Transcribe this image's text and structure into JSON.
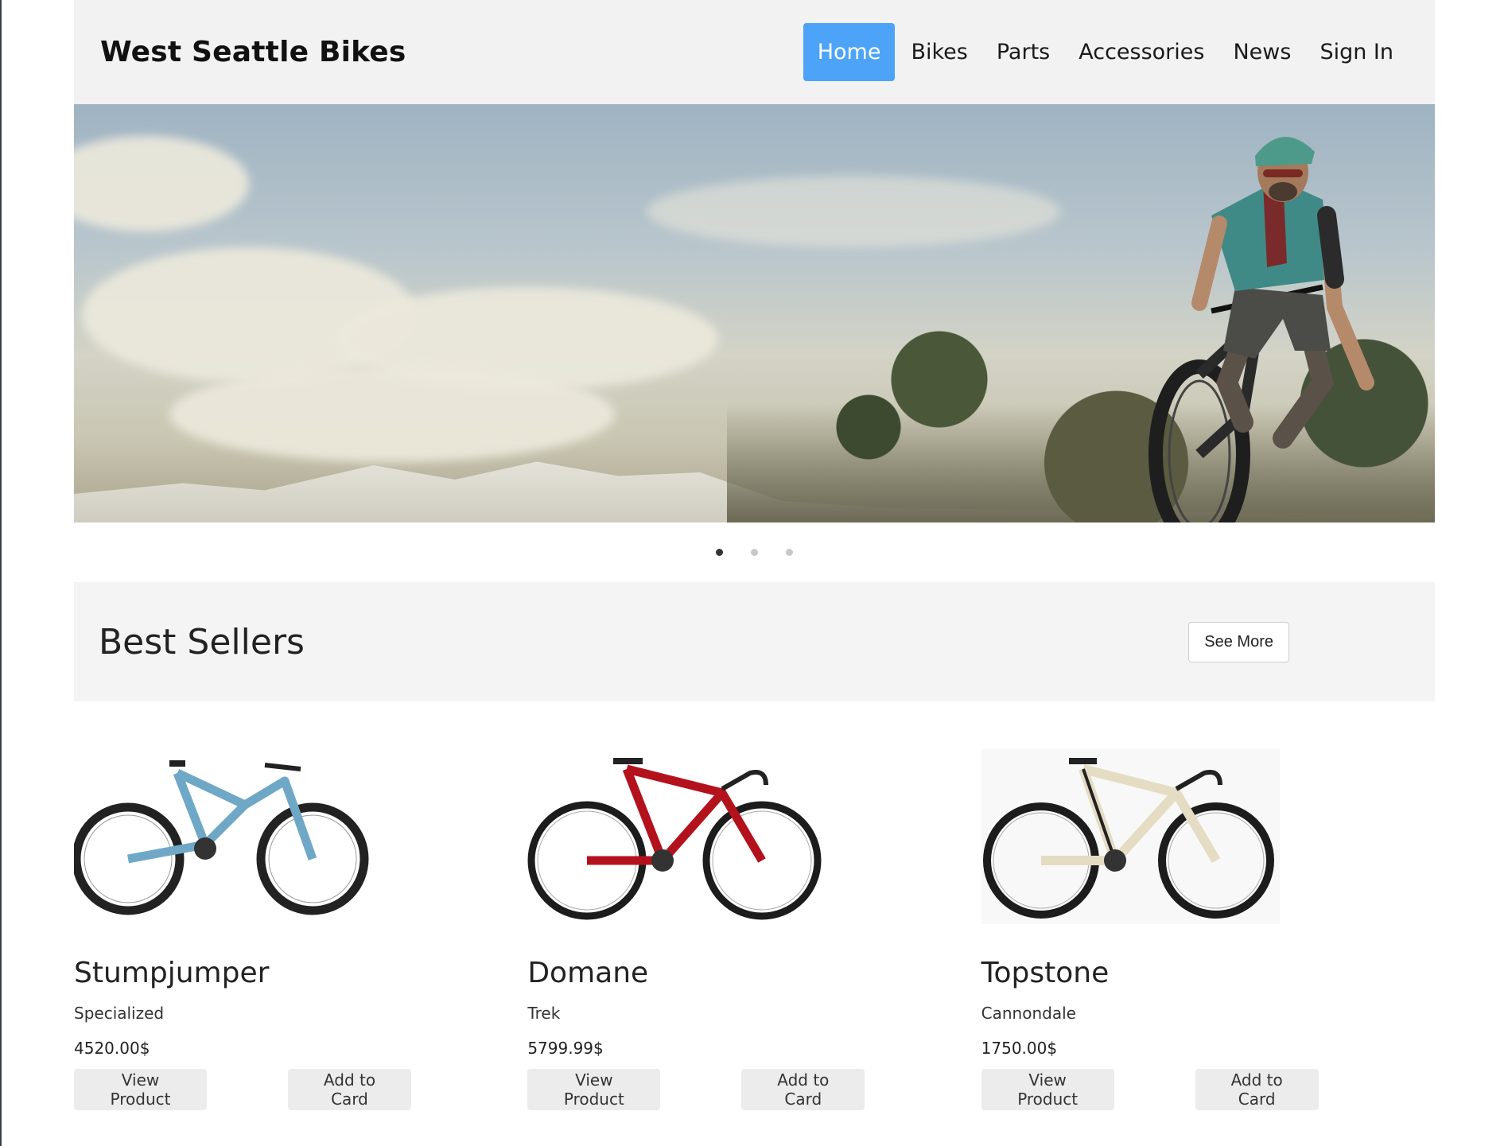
{
  "header": {
    "brand": "West Seattle Bikes",
    "nav": [
      {
        "label": "Home",
        "active": true
      },
      {
        "label": "Bikes",
        "active": false
      },
      {
        "label": "Parts",
        "active": false
      },
      {
        "label": "Accessories",
        "active": false
      },
      {
        "label": "News",
        "active": false
      },
      {
        "label": "Sign In",
        "active": false
      }
    ]
  },
  "carousel": {
    "slide_description": "mountain-biker-hero-photo",
    "slides": 3,
    "active_index": 0
  },
  "best_sellers": {
    "title": "Best Sellers",
    "see_more": "See More",
    "products": [
      {
        "name": "Stumpjumper",
        "brand": "Specialized",
        "price": "4520.00$",
        "view_label": "View Product",
        "add_label": "Add to Card",
        "frame_color": "#6fa8c7"
      },
      {
        "name": "Domane",
        "brand": "Trek",
        "price": "5799.99$",
        "view_label": "View Product",
        "add_label": "Add to Card",
        "frame_color": "#b3121d"
      },
      {
        "name": "Topstone",
        "brand": "Cannondale",
        "price": "1750.00$",
        "view_label": "View Product",
        "add_label": "Add to Card",
        "frame_color": "#e4dcc3"
      }
    ]
  },
  "colors": {
    "accent": "#4da3f7",
    "header_bg": "#f2f2f2",
    "section_bg": "#f4f4f4",
    "button_bg": "#ececec"
  }
}
